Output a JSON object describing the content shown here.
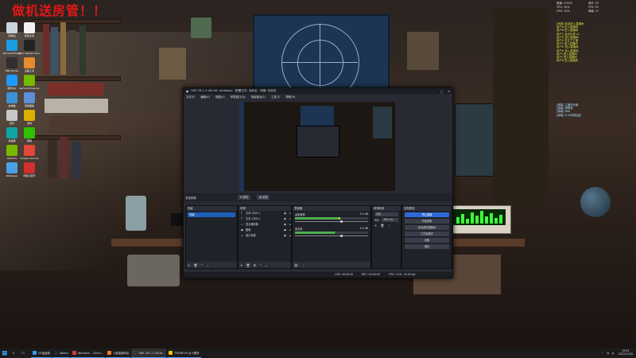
{
  "banner": "做机送房管！！",
  "desktop_icons": [
    {
      "label": "回收站",
      "color": "#c9d4de"
    },
    {
      "label": "新建文本",
      "color": "#f2f2f2"
    },
    {
      "label": "Microsoft Edge",
      "color": "#1b9de2"
    },
    {
      "label": "Epic Games Launcher",
      "color": "#222222"
    },
    {
      "label": "OBS Studio",
      "color": "#302e31"
    },
    {
      "label": "直播工具",
      "color": "#e88a2d"
    },
    {
      "label": "腾讯QQ",
      "color": "#1f9bff"
    },
    {
      "label": "GeForce Experience",
      "color": "#76b900"
    },
    {
      "label": "此电脑",
      "color": "#3d8fd6"
    },
    {
      "label": "控制面板",
      "color": "#5c8fd8"
    },
    {
      "label": "音乐",
      "color": "#c8c8c8"
    },
    {
      "label": "游戏",
      "color": "#d9b100"
    },
    {
      "label": "加速器",
      "color": "#0fa4a4"
    },
    {
      "label": "微信",
      "color": "#2dc100"
    },
    {
      "label": "GeForce",
      "color": "#76b900"
    },
    {
      "label": "Google Chrome",
      "color": "#e4473a"
    },
    {
      "label": "Wallpaper",
      "color": "#4aa0e6"
    },
    {
      "label": "网易云音乐",
      "color": "#d22f2f"
    }
  ],
  "overlay": {
    "stats": [
      "直播: 47633",
      "观众: 52",
      "CPU: 40%",
      "FPS: 59",
      "GPU: 30%",
      "弹幕: 27"
    ],
    "events": [
      "[系统] 欢迎进入直播间",
      "用户A 进入直播间",
      "用户B 进入直播间",
      "用户C 送出礼物 x1",
      "用户D 进入直播间",
      "用户E 关注了主播",
      "用户F 进入直播间",
      "用户G 进入直播间",
      "用户H 进入直播间",
      "用户I 进入直播间",
      "用户J 进入直播间",
      "用户K 进入直播间"
    ],
    "messages": [
      "[弹幕] 主播好厉害",
      "[弹幕] 求歌单",
      "[弹幕] 666",
      "[弹幕] 什么时候抽奖"
    ]
  },
  "obs": {
    "title": "OBS 28.1.2 (64-bit, windows) - 配置文件: 未命名 - 场景: 未命名",
    "menu": [
      "文件(F)",
      "编辑(E)",
      "视图(V)",
      "停靠窗口(D)",
      "场景集合(S)",
      "工具(T)",
      "帮助(H)"
    ],
    "scene_label": "未选择源",
    "properties_btn": "属性",
    "filters_btn": "滤镜",
    "docks": {
      "scenes": {
        "title": "场景",
        "items": [
          "场景"
        ]
      },
      "sources": {
        "title": "来源",
        "items": [
          {
            "icon": "text-icon",
            "label": "文本 (GDI+)"
          },
          {
            "icon": "text-icon",
            "label": "文本 (GDI+)"
          },
          {
            "icon": "display-icon",
            "label": "显示器采集"
          },
          {
            "icon": "image-icon",
            "label": "图像"
          },
          {
            "icon": "window-icon",
            "label": "窗口采集"
          }
        ]
      },
      "mixer": {
        "title": "混音器",
        "channels": [
          {
            "name": "桌面音频",
            "db": "0.0 dB",
            "level": 0.62
          },
          {
            "name": "麦克风",
            "db": "0.0 dB",
            "level": 0.55
          }
        ]
      },
      "transitions": {
        "title": "转场特效",
        "type": "淡出",
        "duration_label": "时长",
        "duration": "300 ms"
      },
      "controls": {
        "title": "控制按钮",
        "buttons": [
          "停止直播",
          "开始录制",
          "启动虚拟摄像机",
          "工作室模式",
          "设置",
          "退出"
        ]
      }
    },
    "status": {
      "live": "LIVE: 00:00:00",
      "rec": "REC: 00:00:00",
      "cpu": "CPU: 0.2%, 30.00 fps"
    }
  },
  "taskbar": {
    "tasks": [
      {
        "label": "US迷迷湖",
        "color": "#3a9af0"
      },
      {
        "label": "Steam",
        "color": "#1b2838"
      },
      {
        "label": "Attention - Charli...",
        "color": "#d23b3b"
      },
      {
        "label": "斗鱼直播伴侣",
        "color": "#ff7a1a"
      },
      {
        "label": "OBS 28.1.2 (64-bi...",
        "color": "#3a3a3a"
      },
      {
        "label": "TMGB029-全十题衣",
        "color": "#f0c400"
      }
    ],
    "time": "19:03",
    "date": "2022/12/16"
  }
}
